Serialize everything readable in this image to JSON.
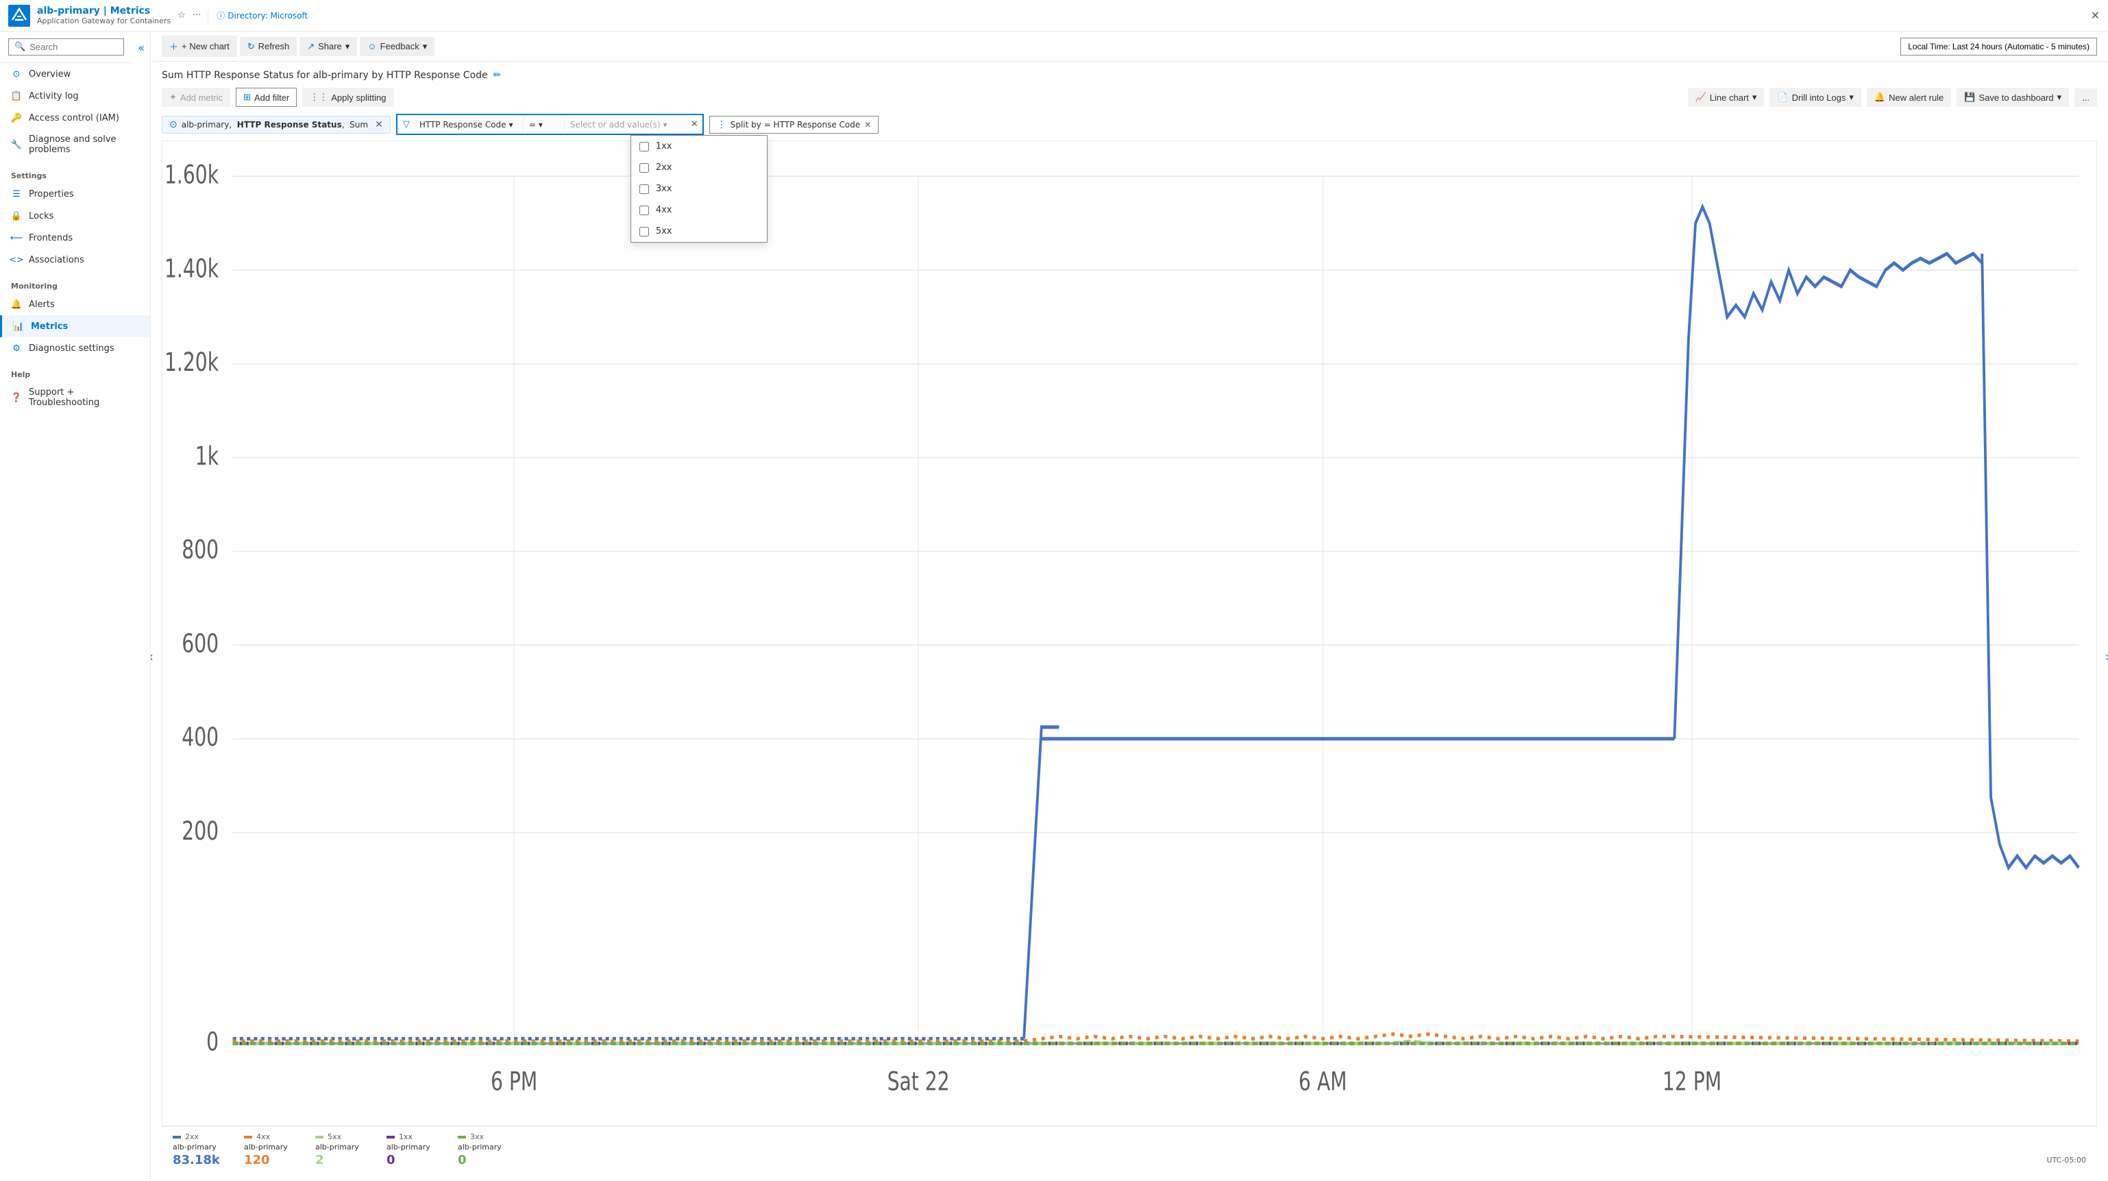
{
  "titleBar": {
    "appName": "alb-primary | Metrics",
    "appSubtitle": "Application Gateway for Containers",
    "directory": "Directory: Microsoft",
    "closeLabel": "✕"
  },
  "sidebar": {
    "searchPlaceholder": "Search",
    "items": [
      {
        "id": "overview",
        "label": "Overview",
        "icon": "overview"
      },
      {
        "id": "activity-log",
        "label": "Activity log",
        "icon": "activity"
      },
      {
        "id": "access-control",
        "label": "Access control (IAM)",
        "icon": "iam"
      },
      {
        "id": "diagnose",
        "label": "Diagnose and solve problems",
        "icon": "diagnose"
      }
    ],
    "sections": [
      {
        "label": "Settings",
        "items": [
          {
            "id": "properties",
            "label": "Properties",
            "icon": "properties"
          },
          {
            "id": "locks",
            "label": "Locks",
            "icon": "locks"
          },
          {
            "id": "frontends",
            "label": "Frontends",
            "icon": "frontends"
          },
          {
            "id": "associations",
            "label": "Associations",
            "icon": "associations"
          }
        ]
      },
      {
        "label": "Monitoring",
        "items": [
          {
            "id": "alerts",
            "label": "Alerts",
            "icon": "alerts"
          },
          {
            "id": "metrics",
            "label": "Metrics",
            "icon": "metrics",
            "active": true
          },
          {
            "id": "diagnostic-settings",
            "label": "Diagnostic settings",
            "icon": "diagnostic"
          }
        ]
      },
      {
        "label": "Help",
        "items": [
          {
            "id": "support",
            "label": "Support + Troubleshooting",
            "icon": "support"
          }
        ]
      }
    ]
  },
  "toolbar": {
    "newChart": "+ New chart",
    "refresh": "Refresh",
    "share": "Share",
    "feedback": "Feedback",
    "timeSelector": "Local Time: Last 24 hours (Automatic - 5 minutes)"
  },
  "chartArea": {
    "title": "Sum HTTP Response Status for alb-primary by HTTP Response Code",
    "editIcon": "✏",
    "secondaryToolbar": {
      "addMetric": "Add metric",
      "addFilter": "Add filter",
      "applySplitting": "Apply splitting",
      "lineChart": "Line chart",
      "drillIntoLogs": "Drill into Logs",
      "newAlertRule": "New alert rule",
      "saveToDashboard": "Save to dashboard",
      "moreOptions": "..."
    },
    "filterBar": {
      "metricChip": {
        "resource": "alb-primary",
        "metric": "HTTP Response Status",
        "aggregation": "Sum"
      },
      "filter": {
        "icon": "🔽",
        "property": "HTTP Response Code",
        "operator": "=",
        "valuePlaceholder": "Select or add value(s)"
      },
      "splitBy": "Split by = HTTP Response Code"
    },
    "valuesDropdown": {
      "options": [
        "1xx",
        "2xx",
        "3xx",
        "4xx",
        "5xx"
      ]
    },
    "yAxisLabels": [
      "1.60k",
      "1.40k",
      "1.20k",
      "1k",
      "800",
      "600",
      "400",
      "200",
      "0"
    ],
    "xAxisLabels": [
      "6 PM",
      "Sat 22",
      "6 AM",
      "12 PM",
      "UTC-05:00"
    ],
    "legend": [
      {
        "code": "2xx",
        "name": "alb-primary",
        "value": "83.18k",
        "color": "#4472C4"
      },
      {
        "code": "4xx",
        "name": "alb-primary",
        "value": "120",
        "color": "#ED7D31"
      },
      {
        "code": "5xx",
        "name": "alb-primary",
        "value": "2",
        "color": "#A9D18E"
      },
      {
        "code": "1xx",
        "name": "alb-primary",
        "value": "0",
        "color": "#7030A0"
      },
      {
        "code": "3xx",
        "name": "alb-primary",
        "value": "0",
        "color": "#70AD47"
      }
    ],
    "utcLabel": "UTC-05:00"
  }
}
